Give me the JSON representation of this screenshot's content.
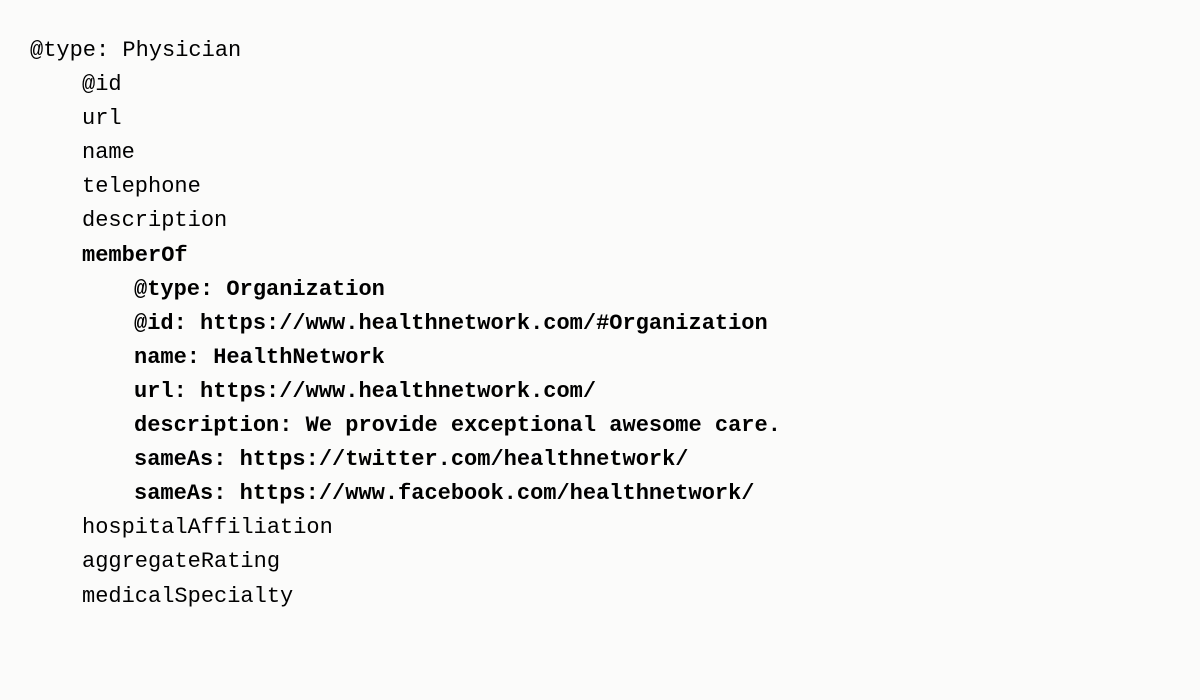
{
  "root": {
    "type_label": "@type: ",
    "type_value": "Physician",
    "props": [
      "@id",
      "url",
      "name",
      "telephone",
      "description"
    ],
    "memberOf_label": "memberOf",
    "memberOf": {
      "lines": [
        {
          "k": "@type: ",
          "v": "Organization"
        },
        {
          "k": "@id: ",
          "v": "https://www.healthnetwork.com/#Organization"
        },
        {
          "k": "name: ",
          "v": "HealthNetwork"
        },
        {
          "k": "url: ",
          "v": "https://www.healthnetwork.com/"
        },
        {
          "k": "description: ",
          "v": "We provide exceptional awesome care."
        },
        {
          "k": "sameAs: ",
          "v": "https://twitter.com/healthnetwork/"
        },
        {
          "k": "sameAs: ",
          "v": "https://www.facebook.com/healthnetwork/"
        }
      ]
    },
    "trailing_props": [
      "hospitalAffiliation",
      "aggregateRating",
      "medicalSpecialty"
    ]
  }
}
